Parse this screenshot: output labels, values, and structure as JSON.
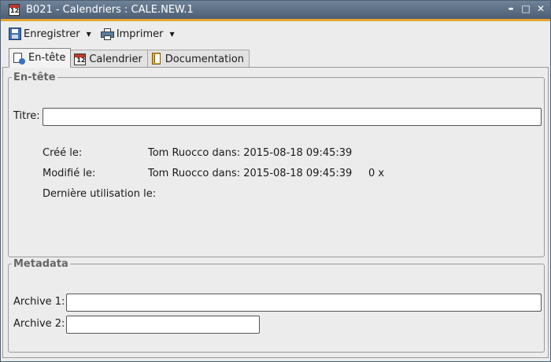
{
  "window": {
    "title": "B021 - Calendriers : CALE.NEW.1",
    "icon_text": "12",
    "controls": {
      "minimize": "▬",
      "maximize": "□",
      "close": "✕"
    }
  },
  "toolbar": {
    "save_label": "Enregistrer",
    "print_label": "Imprimer",
    "caret": "▼"
  },
  "tabs": [
    {
      "label": "En-tête",
      "icon": "header-doc-icon",
      "active": true
    },
    {
      "label": "Calendrier",
      "icon": "calendar-icon",
      "active": false
    },
    {
      "label": "Documentation",
      "icon": "book-icon",
      "active": false
    }
  ],
  "header_group": {
    "legend": "En-tête",
    "title_label": "Titre:",
    "title_value": "",
    "created_label": "Créé le:",
    "created_value": "Tom Ruocco dans: 2015-08-18 09:45:39",
    "modified_label": "Modifié le:",
    "modified_value": "Tom Ruocco dans: 2015-08-18 09:45:39",
    "modified_count": "0 x",
    "last_used_label": "Dernière utilisation le:",
    "last_used_value": ""
  },
  "metadata_group": {
    "legend": "Metadata",
    "archive1_label": "Archive 1:",
    "archive1_value": "",
    "archive2_label": "Archive 2:",
    "archive2_value": ""
  },
  "colors": {
    "titlebar": "#5a6c82",
    "accent": "#e3a72f"
  }
}
